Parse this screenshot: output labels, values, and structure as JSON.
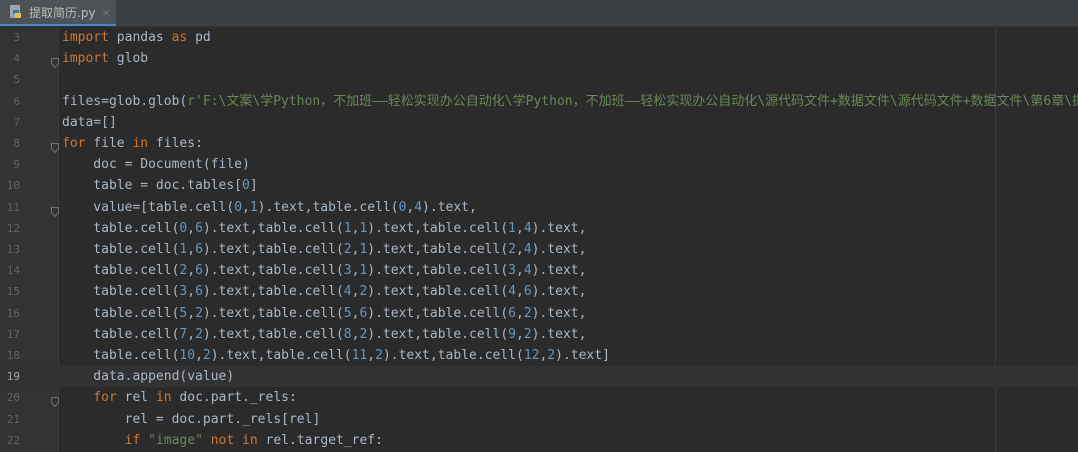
{
  "tab": {
    "filename": "提取简历.py",
    "close": "×"
  },
  "lines": [
    {
      "n": "3",
      "text": "import pandas as pd"
    },
    {
      "n": "4",
      "text": "import glob"
    },
    {
      "n": "5",
      "text": ""
    },
    {
      "n": "6",
      "text": "files=glob.glob(r'F:\\文案\\学Python，不加班——轻松实现办公自动化\\学Python，不加班——轻松实现办公自动化\\源代码文件+数据文件\\源代码文件+数据文件\\第6章\\提取简"
    },
    {
      "n": "7",
      "text": "data=[]"
    },
    {
      "n": "8",
      "text": "for file in files:"
    },
    {
      "n": "9",
      "text": "    doc = Document(file)"
    },
    {
      "n": "10",
      "text": "    table = doc.tables[0]"
    },
    {
      "n": "11",
      "text": "    value=[table.cell(0,1).text,table.cell(0,4).text,"
    },
    {
      "n": "12",
      "text": "    table.cell(0,6).text,table.cell(1,1).text,table.cell(1,4).text,"
    },
    {
      "n": "13",
      "text": "    table.cell(1,6).text,table.cell(2,1).text,table.cell(2,4).text,"
    },
    {
      "n": "14",
      "text": "    table.cell(2,6).text,table.cell(3,1).text,table.cell(3,4).text,"
    },
    {
      "n": "15",
      "text": "    table.cell(3,6).text,table.cell(4,2).text,table.cell(4,6).text,"
    },
    {
      "n": "16",
      "text": "    table.cell(5,2).text,table.cell(5,6).text,table.cell(6,2).text,"
    },
    {
      "n": "17",
      "text": "    table.cell(7,2).text,table.cell(8,2).text,table.cell(9,2).text,"
    },
    {
      "n": "18",
      "text": "    table.cell(10,2).text,table.cell(11,2).text,table.cell(12,2).text]"
    },
    {
      "n": "19",
      "text": "    data.append(value)"
    },
    {
      "n": "20",
      "text": "    for rel in doc.part._rels:"
    },
    {
      "n": "21",
      "text": "        rel = doc.part._rels[rel]"
    },
    {
      "n": "22",
      "text": "        if \"image\" not in rel.target_ref:"
    }
  ],
  "current_line": "19",
  "colors": {
    "background": "#2b2b2b",
    "keyword": "#cc7832",
    "number": "#6897bb",
    "string": "#6a8759",
    "text": "#a9b7c6"
  }
}
